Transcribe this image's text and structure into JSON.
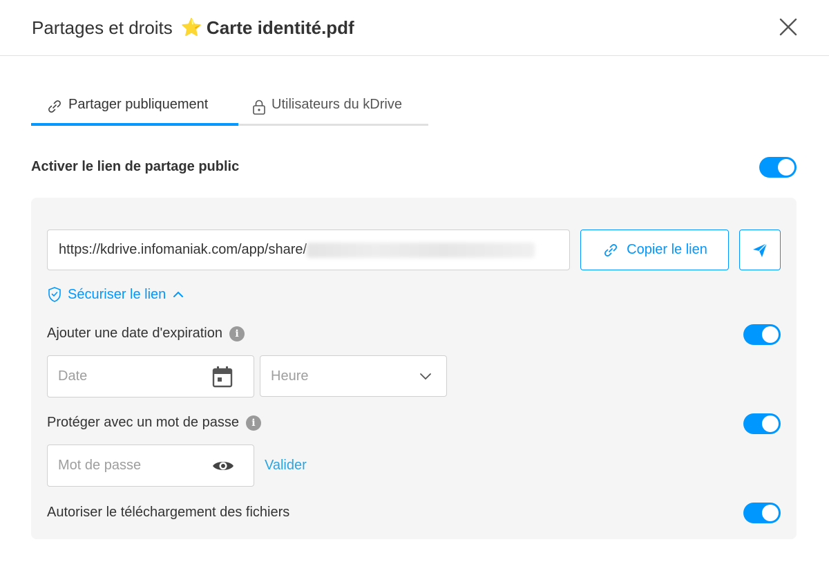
{
  "header": {
    "title": "Partages et droits",
    "star": "⭐",
    "file_name": "Carte identité.pdf"
  },
  "tabs": [
    {
      "label": "Partager publiquement",
      "active": true,
      "icon": "link-icon"
    },
    {
      "label": "Utilisateurs du kDrive",
      "active": false,
      "icon": "lock-icon"
    }
  ],
  "public_link": {
    "label": "Activer le lien de partage public",
    "enabled": true,
    "url_visible": "https://kdrive.infomaniak.com/app/share/",
    "copy_label": "Copier le lien"
  },
  "secure": {
    "label": "Sécuriser le lien",
    "expanded": true
  },
  "expiration": {
    "label": "Ajouter une date d'expiration",
    "enabled": true,
    "date_placeholder": "Date",
    "time_placeholder": "Heure"
  },
  "password": {
    "label": "Protéger avec un mot de passe",
    "enabled": true,
    "placeholder": "Mot de passe",
    "submit_label": "Valider"
  },
  "download": {
    "label": "Autoriser le téléchargement des fichiers",
    "enabled": true
  },
  "colors": {
    "accent": "#0098ff",
    "panel_bg": "#f5f5f5",
    "text": "#333333"
  }
}
